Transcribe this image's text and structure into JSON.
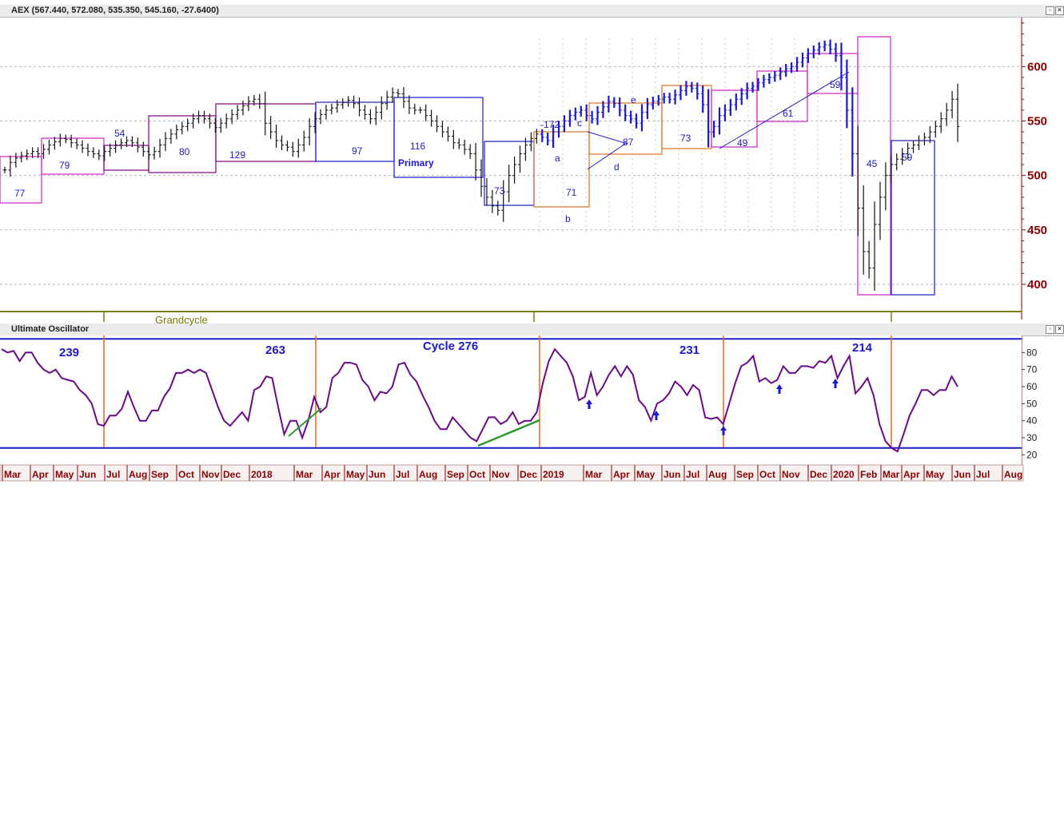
{
  "window": {
    "price_panel_title": "AEX (567.440, 572.080, 535.350, 545.160, -27.6400)",
    "osc_panel_title": "Ultimate Oscillator"
  },
  "colors": {
    "bars": "#111111",
    "bars_blue": "#1a1acc",
    "oscillator": "#6a0a8a",
    "cycle_line": "#e8641e",
    "osc_band": "#1a1acc",
    "axis_text": "#8b0000",
    "box_magenta": "#d020c0",
    "box_purple": "#800080",
    "box_blue": "#1a1acc",
    "box_orange": "#e07020",
    "green_trend": "#2a9a2a",
    "grand_line": "#808000"
  },
  "chart_data": [
    {
      "type": "ohlc",
      "title": "AEX (567.440, 572.080, 535.350, 545.160, -27.6400)",
      "ylim": [
        375,
        645
      ],
      "y_ticks": [
        400,
        450,
        500,
        550,
        600
      ],
      "weekly_close_estimate": [
        505,
        512,
        516,
        518,
        520,
        522,
        520,
        524,
        528,
        531,
        534,
        533,
        530,
        528,
        525,
        522,
        520,
        518,
        522,
        525,
        528,
        530,
        532,
        530,
        526,
        522,
        519,
        522,
        528,
        534,
        538,
        542,
        545,
        548,
        552,
        555,
        552,
        548,
        544,
        548,
        552,
        556,
        560,
        564,
        568,
        570,
        566,
        548,
        540,
        532,
        528,
        526,
        522,
        528,
        535,
        545,
        552,
        556,
        560,
        562,
        565,
        567,
        569,
        566,
        560,
        556,
        552,
        558,
        566,
        572,
        576,
        575,
        568,
        562,
        560,
        560,
        555,
        550,
        545,
        540,
        536,
        530,
        528,
        524,
        520,
        505,
        490,
        480,
        472,
        468,
        485,
        500,
        510,
        520,
        528,
        534,
        538,
        535,
        532,
        540,
        545,
        550,
        555,
        558,
        560,
        555,
        552,
        558,
        563,
        568,
        566,
        560,
        555,
        552,
        548,
        558,
        565,
        568,
        570,
        572,
        570,
        574,
        578,
        582,
        580,
        575,
        565,
        540,
        545,
        555,
        560,
        565,
        570,
        575,
        580,
        582,
        585,
        588,
        590,
        592,
        595,
        598,
        600,
        604,
        608,
        612,
        615,
        618,
        620,
        616,
        610,
        590,
        560,
        520,
        470,
        430,
        415,
        455,
        480,
        500,
        510,
        515,
        520,
        525,
        528,
        532,
        535,
        540,
        545,
        552,
        560,
        570,
        545
      ],
      "annotations": {
        "box_counts": [
          "77",
          "79",
          "54",
          "80",
          "129",
          "97",
          "116",
          "73",
          "71",
          "87",
          "73",
          "49",
          "61",
          "59",
          "45",
          "59"
        ],
        "primary_label": "Primary",
        "wave_labels": [
          "-172",
          "a",
          "b",
          "c",
          "d",
          "e"
        ],
        "grandcycle_label": "Grandcycle"
      }
    },
    {
      "type": "line",
      "title": "Ultimate Oscillator",
      "ylim": [
        15,
        90
      ],
      "y_ticks": [
        20,
        30,
        40,
        50,
        60,
        70,
        80
      ],
      "band_levels": [
        88,
        24
      ],
      "values": [
        82,
        80,
        81,
        75,
        80,
        80,
        74,
        70,
        68,
        70,
        65,
        64,
        63,
        58,
        55,
        50,
        38,
        37,
        43,
        43,
        47,
        57,
        48,
        40,
        40,
        46,
        46,
        54,
        59,
        68,
        68,
        70,
        68,
        70,
        68,
        58,
        48,
        40,
        37,
        41,
        45,
        40,
        58,
        60,
        66,
        65,
        48,
        32,
        40,
        40,
        30,
        40,
        54,
        45,
        48,
        65,
        68,
        74,
        74,
        73,
        64,
        60,
        52,
        57,
        56,
        60,
        73,
        74,
        67,
        63,
        55,
        48,
        40,
        35,
        35,
        42,
        38,
        34,
        30,
        28,
        35,
        42,
        42,
        38,
        40,
        45,
        38,
        40,
        40,
        45,
        62,
        75,
        82,
        78,
        74,
        66,
        52,
        54,
        68,
        55,
        60,
        67,
        72,
        66,
        72,
        67,
        52,
        48,
        40,
        50,
        52,
        56,
        63,
        60,
        55,
        61,
        58,
        42,
        41,
        42,
        38,
        50,
        62,
        72,
        74,
        78,
        63,
        65,
        62,
        64,
        72,
        68,
        68,
        72,
        72,
        71,
        75,
        74,
        78,
        65,
        72,
        78,
        56,
        60,
        65,
        55,
        38,
        28,
        24,
        22,
        32,
        43,
        50,
        58,
        58,
        55,
        58,
        58,
        66,
        60
      ],
      "cycle_labels": [
        "239",
        "263",
        "Cycle  276",
        "231",
        "214"
      ]
    }
  ],
  "x_axis": {
    "months": [
      "Mar",
      "Apr",
      "May",
      "Jun",
      "Jul",
      "Aug",
      "Sep",
      "Oct",
      "Nov",
      "Dec",
      "2018",
      "Mar",
      "Apr",
      "May",
      "Jun",
      "Jul",
      "Aug",
      "Sep",
      "Oct",
      "Nov",
      "Dec",
      "2019",
      "Mar",
      "Apr",
      "May",
      "Jun",
      "Jul",
      "Aug",
      "Sep",
      "Oct",
      "Nov",
      "Dec",
      "2020",
      "Feb",
      "Mar",
      "Apr",
      "May",
      "Jun",
      "Jul",
      "Aug"
    ]
  }
}
